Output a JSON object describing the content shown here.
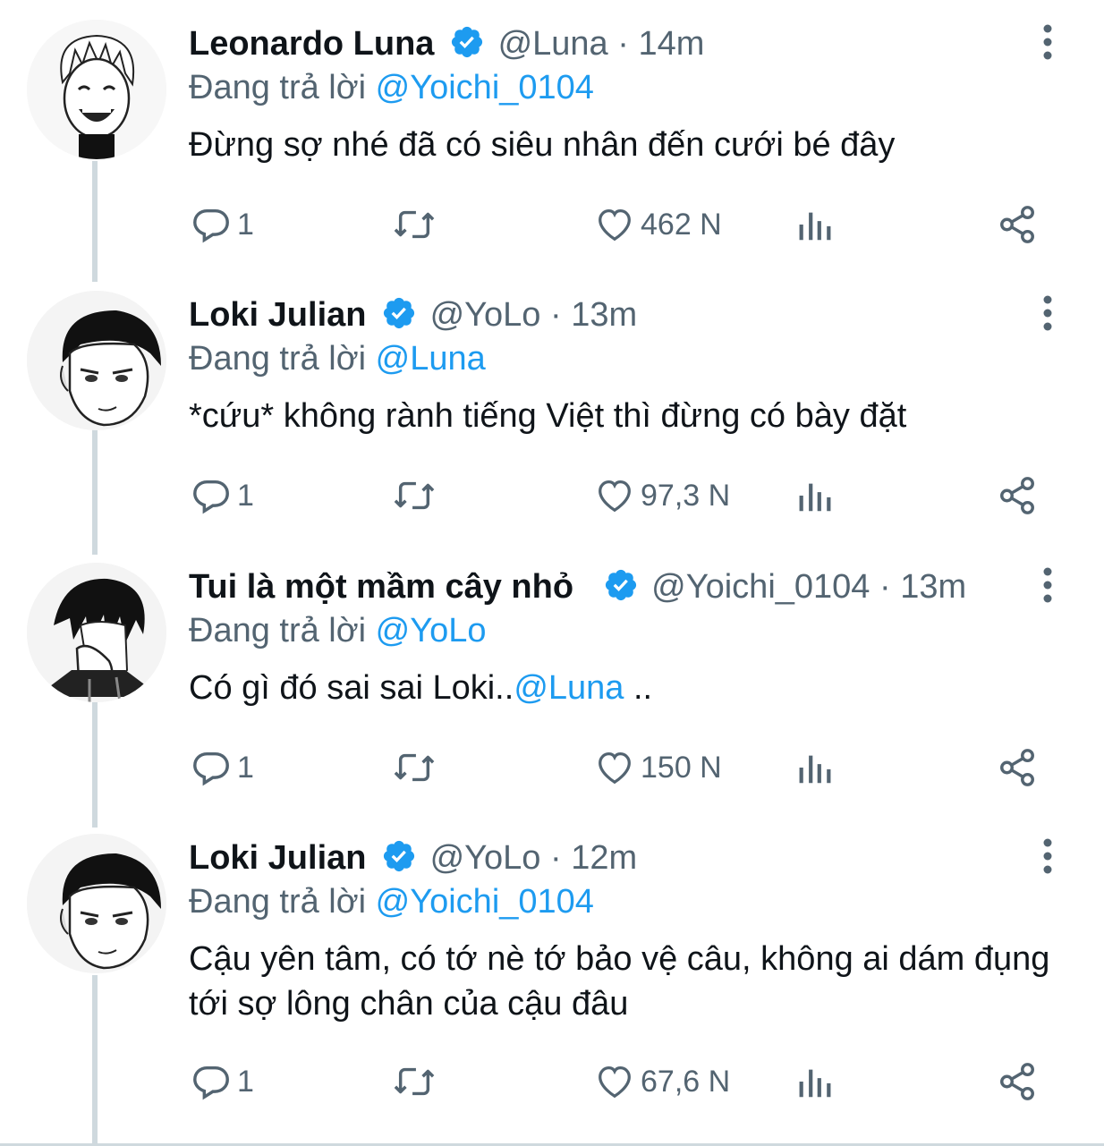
{
  "reply_prefix": "Đang trả lời",
  "tweets": [
    {
      "name": "Leonardo Luna",
      "handle": "@Luna",
      "sep": "·",
      "time": "14m",
      "reply_to": "@Yoichi_0104",
      "text": "Đừng sợ nhé đã có siêu nhân đến cưới bé đây",
      "text_mention": "",
      "text_after": "",
      "replies": "1",
      "likes": "462 N"
    },
    {
      "name": "Loki Julian",
      "handle": "@YoLo",
      "sep": "·",
      "time": "13m",
      "reply_to": "@Luna",
      "text": "*cứu* không rành tiếng Việt thì đừng có bày đặt",
      "text_mention": "",
      "text_after": "",
      "replies": "1",
      "likes": "97,3 N"
    },
    {
      "name": "Tui là một mầm cây nhỏ",
      "handle": "@Yoichi_0104",
      "sep": "·",
      "time": "13m",
      "reply_to": "@YoLo",
      "text": "Có gì đó sai sai Loki..",
      "text_mention": "@Luna",
      "text_after": " ..",
      "replies": "1",
      "likes": "150 N"
    },
    {
      "name": "Loki Julian",
      "handle": "@YoLo",
      "sep": "·",
      "time": "12m",
      "reply_to": "@Yoichi_0104",
      "text": "Cậu yên tâm, có tớ nè tớ bảo vệ câu, không ai dám đụng tới sợ lông chân của cậu đâu",
      "text_mention": "",
      "text_after": "",
      "replies": "1",
      "likes": "67,6 N"
    }
  ],
  "colors": {
    "accent": "#1d9bf0",
    "secondary_text": "#536471",
    "primary_text": "#0f1419",
    "thread_line": "#cfd9de"
  },
  "icons": [
    "verified-badge-icon",
    "more-vertical-icon",
    "reply-icon",
    "retweet-icon",
    "like-icon",
    "views-icon",
    "share-icon"
  ]
}
